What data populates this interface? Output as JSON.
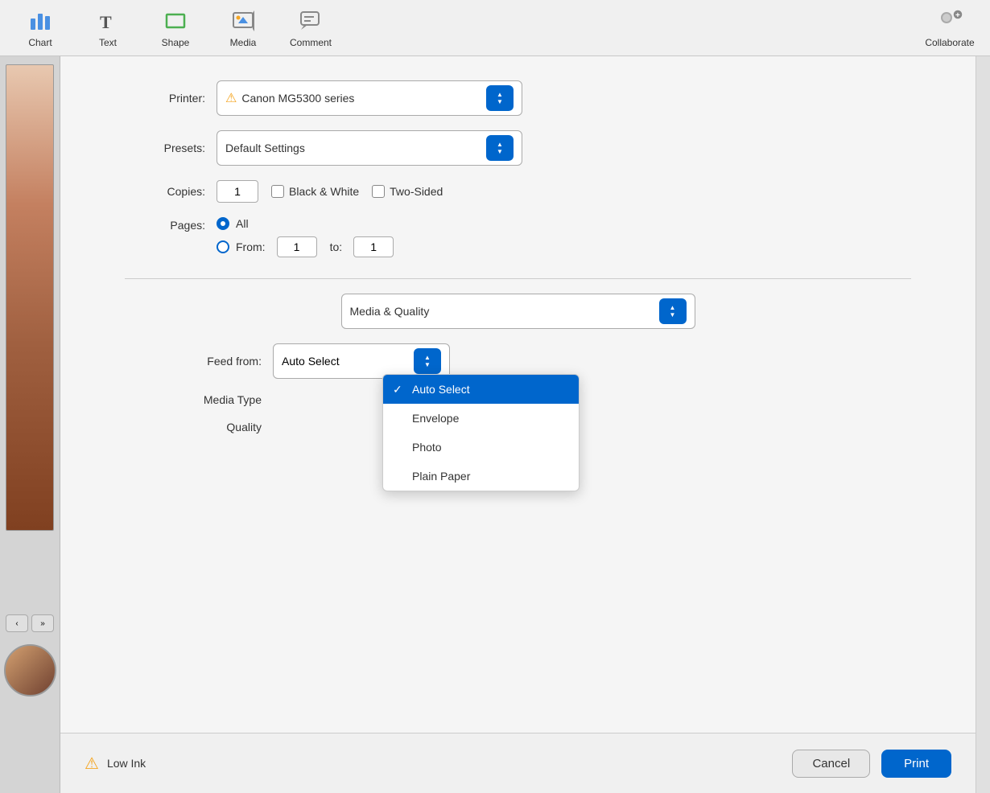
{
  "toolbar": {
    "items": [
      {
        "id": "chart",
        "label": "Chart",
        "icon": "📊"
      },
      {
        "id": "text",
        "label": "Text",
        "icon": "T"
      },
      {
        "id": "shape",
        "label": "Shape",
        "icon": "■"
      },
      {
        "id": "media",
        "label": "Media",
        "icon": "🖼"
      },
      {
        "id": "comment",
        "label": "Comment",
        "icon": "💬"
      }
    ],
    "right_items": [
      {
        "id": "collaborate",
        "label": "Collaborate",
        "icon": "👤+"
      }
    ]
  },
  "print_dialog": {
    "printer_label": "Printer:",
    "printer_value": "Canon MG5300 series",
    "printer_warning": "⚠",
    "presets_label": "Presets:",
    "presets_value": "Default Settings",
    "copies_label": "Copies:",
    "copies_value": "1",
    "black_white_label": "Black & White",
    "two_sided_label": "Two-Sided",
    "pages_label": "Pages:",
    "pages_all_label": "All",
    "pages_from_label": "From:",
    "pages_from_value": "1",
    "pages_to_label": "to:",
    "pages_to_value": "1",
    "section_label": "Media & Quality",
    "feed_from_label": "Feed from:",
    "feed_from_value": "Auto Select",
    "media_type_label": "Media Type",
    "quality_label": "Quality",
    "dropdown_items": [
      {
        "label": "Auto Select",
        "selected": true
      },
      {
        "label": "Envelope",
        "selected": false
      },
      {
        "label": "Photo",
        "selected": false
      },
      {
        "label": "Plain Paper",
        "selected": false
      }
    ]
  },
  "bottom_bar": {
    "warning_icon": "⚠",
    "low_ink_label": "Low Ink",
    "cancel_label": "Cancel",
    "print_label": "Print"
  }
}
